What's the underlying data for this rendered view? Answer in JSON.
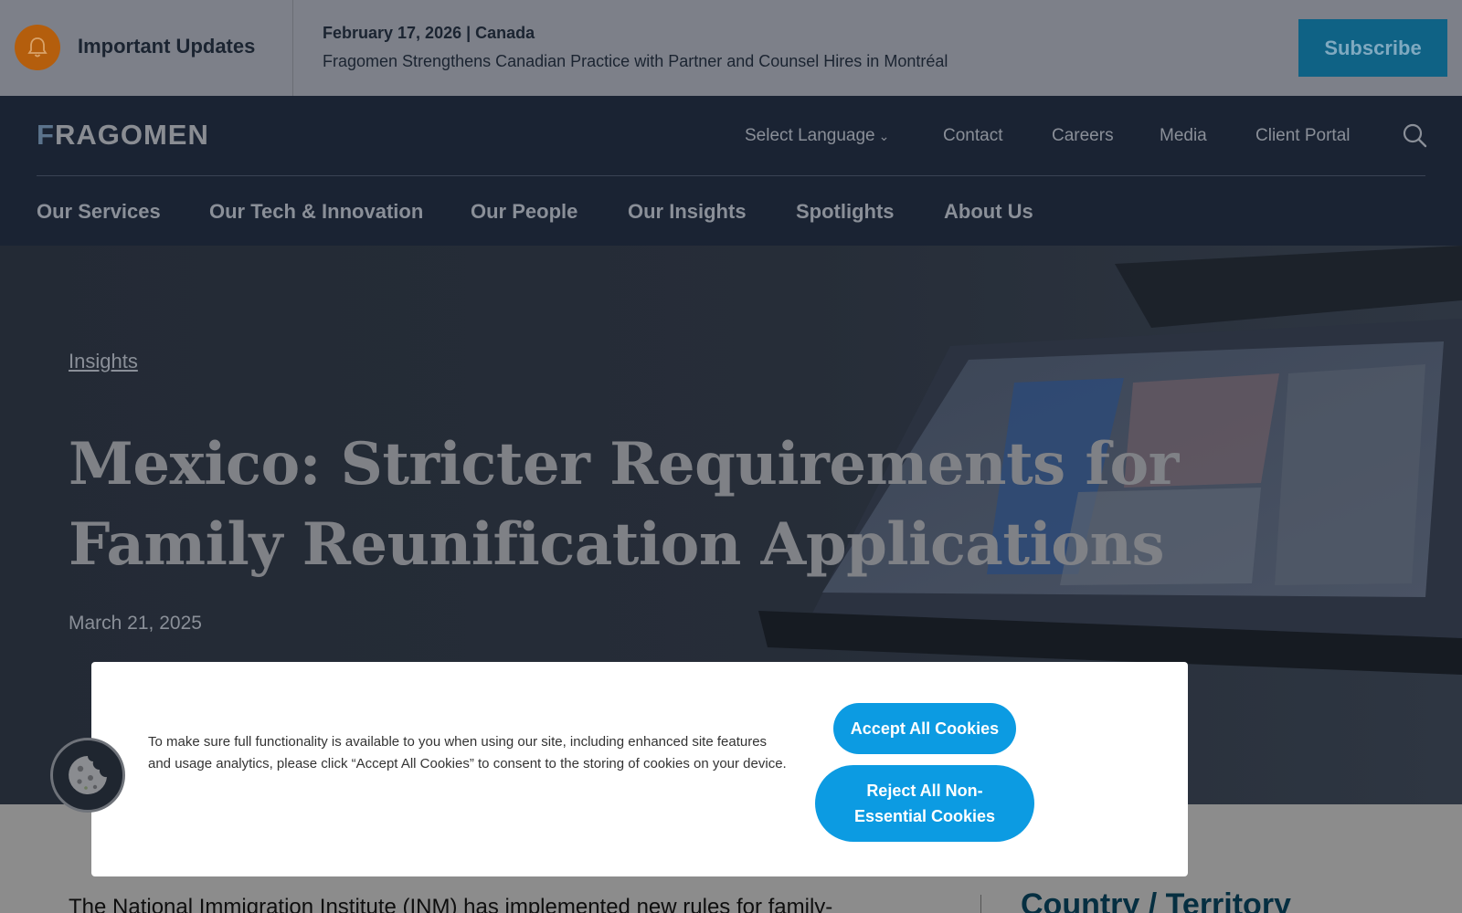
{
  "updates": {
    "title": "Important Updates",
    "date_line": "February 17, 2026 | Canada",
    "headline": "Fragomen Strengthens Canadian Practice with Partner and Counsel Hires in Montréal",
    "subscribe_label": "Subscribe"
  },
  "header": {
    "logo": "FRAGOMEN",
    "utility": {
      "language": "Select Language",
      "contact": "Contact",
      "careers": "Careers",
      "media": "Media",
      "client_portal": "Client Portal"
    },
    "nav": [
      "Our Services",
      "Our Tech & Innovation",
      "Our People",
      "Our Insights",
      "Spotlights",
      "About Us"
    ]
  },
  "hero": {
    "breadcrumb": "Insights",
    "title": "Mexico: Stricter Requirements for Family Reunification Applications",
    "date": "March 21, 2025"
  },
  "article": {
    "intro": "The National Immigration Institute (INM) has implemented new rules for family-",
    "sidebar_heading": "Country / Territory"
  },
  "cookie": {
    "message": "To make sure full functionality is available to you when using our site, including enhanced site features and usage analytics, please click “Accept All Cookies” to consent to the storing of cookies on your device.",
    "accept_label": "Accept All Cookies",
    "reject_label": "Reject All Non-Essential Cookies"
  },
  "colors": {
    "subscribe": "#0f6285",
    "cookie_button": "#0c9be2",
    "header_bg": "#1a2333",
    "bell": "#b45e0d"
  },
  "icons": [
    "bell-icon",
    "chevron-down-icon",
    "search-icon",
    "cookie-icon"
  ]
}
